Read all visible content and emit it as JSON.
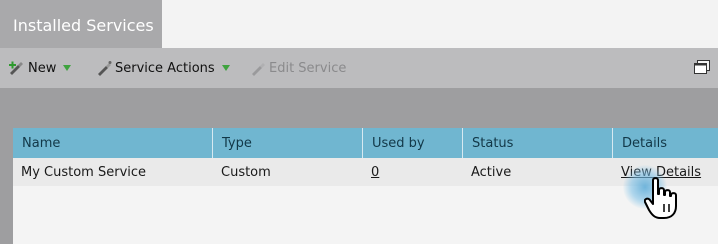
{
  "tab": {
    "label": "Installed Services"
  },
  "toolbar": {
    "new_label": "New",
    "service_actions_label": "Service Actions",
    "edit_service_label": "Edit Service"
  },
  "table": {
    "columns": [
      "Name",
      "Type",
      "Used by",
      "Status",
      "Details"
    ],
    "rows": [
      {
        "name": "My Custom Service",
        "type": "Custom",
        "used_by": "0",
        "status": "Active",
        "details": "View Details"
      }
    ]
  },
  "colors": {
    "tab_bg": "#a9a9ab",
    "toolbar_bg": "#bcbcbe",
    "header_bg": "#70b6d0",
    "drop_arrow": "#3fa33f"
  },
  "icons": [
    "new-icon",
    "service-actions-icon",
    "edit-service-icon",
    "dropdown-arrow-icon",
    "window-icon",
    "hand-cursor-icon"
  ]
}
